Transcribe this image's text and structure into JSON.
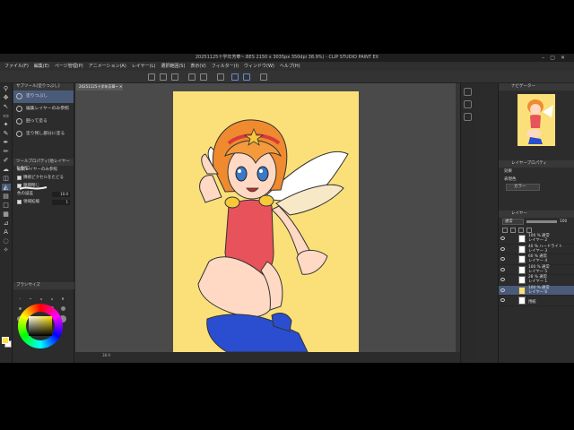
{
  "app": {
    "title": "20251125十学年芳華~.BES 2150 x 3035px 350dpi 38.9%) - CLIP STUDIO PAINT EX",
    "menu": [
      "ファイル(F)",
      "編集(E)",
      "ページ管理(P)",
      "アニメーション(A)",
      "レイヤー(L)",
      "選択範囲(S)",
      "表示(V)",
      "フィルター(I)",
      "ウィンドウ(W)",
      "ヘルプ(H)"
    ],
    "doc_tab": "20251125十学年芳華~"
  },
  "subtool": {
    "header": "サブツール[塗りつぶし]",
    "items": [
      "塗りつぶし",
      "編集レイヤーのみ参照",
      "囲って塗る",
      "塗り残し部分に塗る"
    ],
    "active_index": 0,
    "detail_header": "ツールプロパティ[他レイヤーを参照]",
    "detail_title": "編集レイヤーのみ参照",
    "props": [
      {
        "label": "隣接ピクセルをたどる",
        "checked": true,
        "value": ""
      },
      {
        "label": "隙間閉じ",
        "checked": true,
        "value": ""
      },
      {
        "label": "色の誤差",
        "checked": false,
        "value": "10.0"
      },
      {
        "label": "領域拡縮",
        "checked": true,
        "value": "1"
      }
    ],
    "brush_size_header": "ブラシサイズ"
  },
  "colors": {
    "main": "#ffdf3c",
    "sub": "#ffffff",
    "accent": "#4a5b7a"
  },
  "navigator": {
    "tab": "ナビゲーター"
  },
  "layer_property": {
    "tab": "レイヤープロパティ",
    "effect_label": "効果",
    "expression_label": "表現色",
    "expression_value": "カラー"
  },
  "layers": {
    "tab": "レイヤー",
    "blend": "通常",
    "opacity": "100",
    "rows": [
      {
        "t1": "100 % 通常",
        "t2": "レイヤー 2"
      },
      {
        "t1": "40 % ハードライト",
        "t2": "レイヤー 3"
      },
      {
        "t1": "60 % 通常",
        "t2": "レイヤー 4"
      },
      {
        "t1": "100 % 通常",
        "t2": "レイヤー 5"
      },
      {
        "t1": "28 % 通常",
        "t2": "レイヤー 1"
      },
      {
        "t1": "100 % 通常",
        "t2": "レイヤー 6"
      },
      {
        "t1": "",
        "t2": "用紙"
      }
    ],
    "active_index": 5
  },
  "status": {
    "zoom": "38.9"
  }
}
